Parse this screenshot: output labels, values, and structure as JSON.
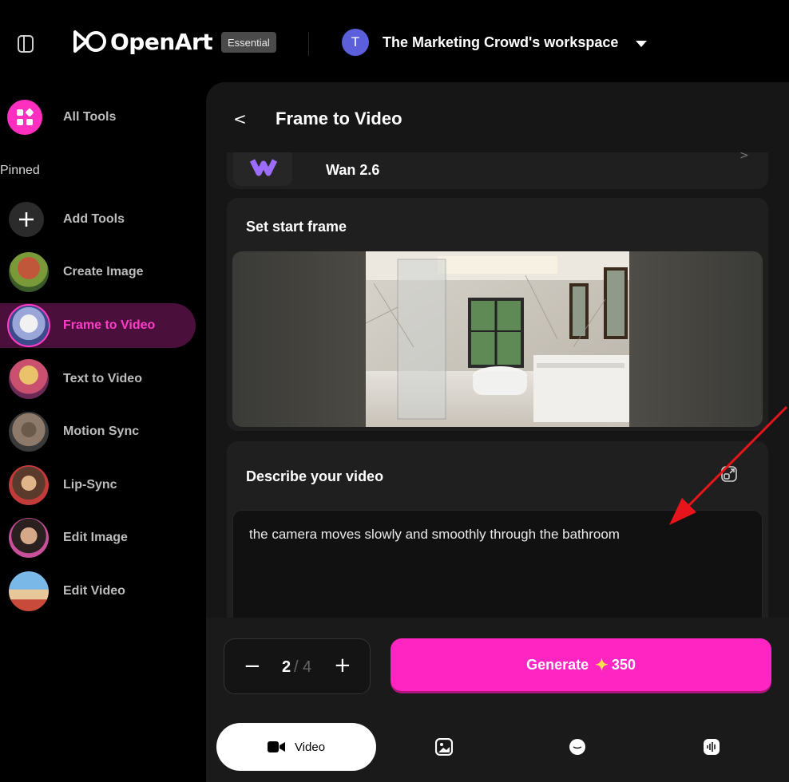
{
  "app": {
    "logo_text": "OpenArt",
    "plan_badge": "Essential",
    "workspace_initial": "T",
    "workspace_name": "The Marketing Crowd's workspace"
  },
  "sidebar": {
    "items": [
      {
        "label": "All Tools"
      },
      {
        "label": "Add Tools"
      },
      {
        "label": "Create Image"
      },
      {
        "label": "Frame to Video",
        "active": true
      },
      {
        "label": "Text to Video"
      },
      {
        "label": "Motion Sync"
      },
      {
        "label": "Lip-Sync"
      },
      {
        "label": "Edit Image"
      },
      {
        "label": "Edit Video"
      }
    ],
    "pinned_label": "Pinned"
  },
  "main": {
    "back_label": "<",
    "title": "Frame to Video",
    "model_name": "Wan 2.6",
    "model_chevron": ">",
    "start_frame_label": "Set start frame",
    "describe_label": "Describe your video",
    "prompt_text": "the camera moves slowly and smoothly through the bathroom"
  },
  "footer": {
    "minus": "−",
    "count": "2",
    "separator": "/",
    "max": "4",
    "plus": "+",
    "generate_label": "Generate",
    "credits": "350"
  },
  "tabs": {
    "video_label": "Video"
  },
  "colors": {
    "accent": "#ff25c3",
    "active_bg": "#4a0f3a",
    "annotation_arrow": "#e8141b"
  }
}
